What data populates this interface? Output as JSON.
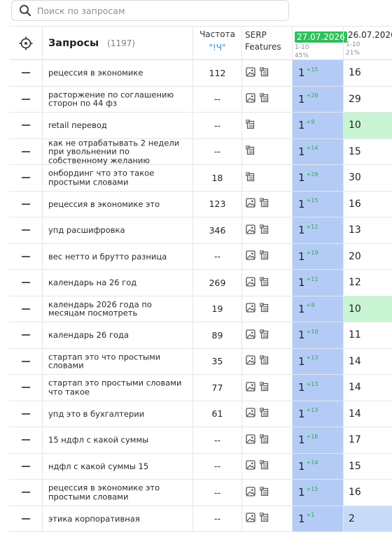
{
  "search": {
    "placeholder": "Поиск по запросам",
    "value": ""
  },
  "header": {
    "title": "Запросы",
    "count": "(1197)",
    "freq_title": "Частота",
    "freq_sub": "\"!Ч\"",
    "serp_line1": "SERP",
    "serp_line2": "Features",
    "date1": "27.07.2026",
    "date1_range": "1-10",
    "date1_pct": "45%",
    "date2": "26.07.2026",
    "date2_range": "1-10",
    "date2_pct": "21%"
  },
  "colors": {
    "accent_green": "#2ec05a",
    "current_col": "#b4ccf5",
    "prev_green": "#c9f5d5",
    "prev_blue": "#c7dbf8",
    "freq_link": "#2f8fd6"
  },
  "rows": [
    {
      "query": "рецессия в экономике",
      "freq": "112",
      "img": true,
      "pos": "1",
      "delta": "+15",
      "prev": "16",
      "prev_hl": ""
    },
    {
      "query": "расторжение по соглашению сторон по 44 фз",
      "freq": "--",
      "img": true,
      "pos": "1",
      "delta": "+28",
      "prev": "29",
      "prev_hl": ""
    },
    {
      "query": "retail перевод",
      "freq": "--",
      "img": false,
      "pos": "1",
      "delta": "+9",
      "prev": "10",
      "prev_hl": "g"
    },
    {
      "query": "как не отрабатывать 2 недели при увольнении по собственному желанию",
      "freq": "--",
      "img": false,
      "pos": "1",
      "delta": "+14",
      "prev": "15",
      "prev_hl": ""
    },
    {
      "query": "онбординг что это такое простыми словами",
      "freq": "18",
      "img": false,
      "pos": "1",
      "delta": "+29",
      "prev": "30",
      "prev_hl": ""
    },
    {
      "query": "рецессия в экономике это",
      "freq": "123",
      "img": true,
      "pos": "1",
      "delta": "+15",
      "prev": "16",
      "prev_hl": ""
    },
    {
      "query": "упд расшифровка",
      "freq": "346",
      "img": true,
      "pos": "1",
      "delta": "+12",
      "prev": "13",
      "prev_hl": ""
    },
    {
      "query": "вес нетто и брутто разница",
      "freq": "--",
      "img": true,
      "pos": "1",
      "delta": "+19",
      "prev": "20",
      "prev_hl": ""
    },
    {
      "query": "календарь на 26 год",
      "freq": "269",
      "img": true,
      "pos": "1",
      "delta": "+11",
      "prev": "12",
      "prev_hl": ""
    },
    {
      "query": "календарь 2026 года по месяцам посмотреть",
      "freq": "19",
      "img": true,
      "pos": "1",
      "delta": "+9",
      "prev": "10",
      "prev_hl": "g"
    },
    {
      "query": "календарь 26 года",
      "freq": "89",
      "img": true,
      "pos": "1",
      "delta": "+10",
      "prev": "11",
      "prev_hl": ""
    },
    {
      "query": "стартап это что простыми словами",
      "freq": "35",
      "img": true,
      "pos": "1",
      "delta": "+13",
      "prev": "14",
      "prev_hl": ""
    },
    {
      "query": "стартап это простыми словами что такое",
      "freq": "77",
      "img": true,
      "pos": "1",
      "delta": "+13",
      "prev": "14",
      "prev_hl": ""
    },
    {
      "query": "упд это в бухгалтерии",
      "freq": "61",
      "img": true,
      "pos": "1",
      "delta": "+13",
      "prev": "14",
      "prev_hl": ""
    },
    {
      "query": "15 ндфл с какой суммы",
      "freq": "--",
      "img": true,
      "pos": "1",
      "delta": "+16",
      "prev": "17",
      "prev_hl": ""
    },
    {
      "query": "ндфл с какой суммы 15",
      "freq": "--",
      "img": true,
      "pos": "1",
      "delta": "+14",
      "prev": "15",
      "prev_hl": ""
    },
    {
      "query": "рецессия в экономике это простыми словами",
      "freq": "--",
      "img": true,
      "pos": "1",
      "delta": "+15",
      "prev": "16",
      "prev_hl": ""
    },
    {
      "query": "этика корпоративная",
      "freq": "--",
      "img": true,
      "pos": "1",
      "delta": "+1",
      "prev": "2",
      "prev_hl": "b"
    }
  ]
}
